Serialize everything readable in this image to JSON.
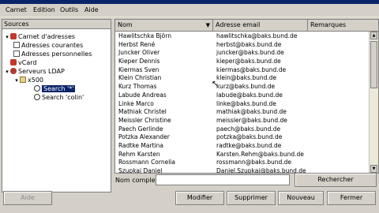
{
  "menu": [
    {
      "label": "Carnet"
    },
    {
      "label": "Edition"
    },
    {
      "label": "Outils"
    },
    {
      "label": "Aide"
    }
  ],
  "sources": {
    "header": "Sources",
    "tree": [
      {
        "label": "Carnet d'adresses",
        "icon": "address-book-icon",
        "twisty": "▾"
      },
      {
        "label": "Adresses courantes",
        "icon": "card-icon",
        "twisty": ""
      },
      {
        "label": "Adresses personnelles",
        "icon": "card-icon",
        "twisty": ""
      },
      {
        "label": "vCard",
        "icon": "address-book-icon",
        "twisty": ""
      },
      {
        "label": "Serveurs LDAP",
        "icon": "server-icon",
        "twisty": "▾"
      },
      {
        "label": "x500",
        "icon": "folder-icon",
        "twisty": "▾"
      },
      {
        "label": "Search '*'",
        "icon": "search-icon",
        "twisty": ""
      },
      {
        "label": "Search 'colin'",
        "icon": "search-icon",
        "twisty": ""
      }
    ]
  },
  "results": {
    "columns": [
      "Nom",
      "Adresse email",
      "Remarques"
    ],
    "rows": [
      {
        "name": "Hawlitschka Björn",
        "email": "hawlitschka@baks.bund.de"
      },
      {
        "name": "Herbst René",
        "email": "herbst@baks.bund.de"
      },
      {
        "name": "Juncker Oliver",
        "email": "juncker@baks.bund.de"
      },
      {
        "name": "Kieper Dennis",
        "email": "kieper@baks.bund.de"
      },
      {
        "name": "Kiermas Sven",
        "email": "kiermas@baks.bund.de"
      },
      {
        "name": "Klein Christian",
        "email": "klein@baks.bund.de"
      },
      {
        "name": "Kurz Thomas",
        "email": "kurz@baks.bund.de"
      },
      {
        "name": "Labude Andreas",
        "email": "labude@baks.bund.de"
      },
      {
        "name": "Linke Marco",
        "email": "linke@baks.bund.de"
      },
      {
        "name": "Mathiak Christel",
        "email": "mathiak@baks.bund.de"
      },
      {
        "name": "Meissler Christine",
        "email": "meissler@baks.bund.de"
      },
      {
        "name": "Paech Gerlinde",
        "email": "paech@baks.bund.de"
      },
      {
        "name": "Potzka Alexander",
        "email": "potzka@baks.bund.de"
      },
      {
        "name": "Radtke Martina",
        "email": "radtke@baks.bund.de"
      },
      {
        "name": "Rehm Karsten",
        "email": "Karsten.Rehm@baks.bund.de"
      },
      {
        "name": "Rossmann Cornelia",
        "email": "rossmann@baks.bund.de"
      },
      {
        "name": "Szupkai Daniel",
        "email": "Daniel.Szupkai@baks.bund.de"
      }
    ]
  },
  "search": {
    "label": "Nom complet :",
    "value": "",
    "button": "Rechercher"
  },
  "buttons": {
    "help": "Aide",
    "modify": "Modifier",
    "delete": "Supprimer",
    "new": "Nouveau",
    "close": "Fermer"
  }
}
